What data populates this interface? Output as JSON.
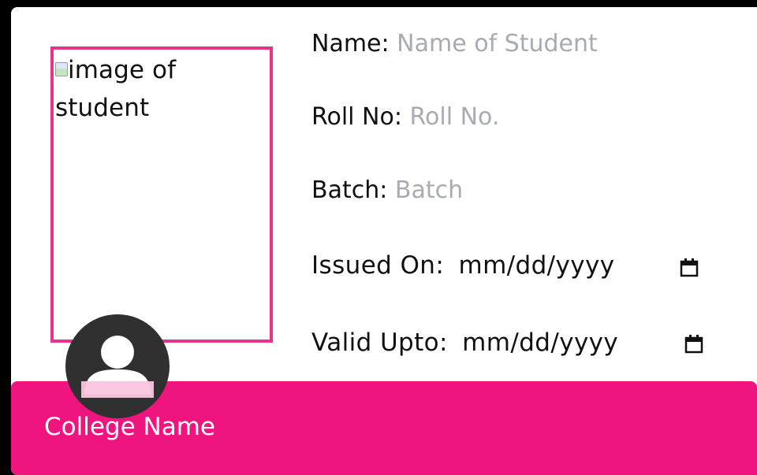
{
  "photo": {
    "alt_text": "image of student"
  },
  "fields": {
    "name": {
      "label": "Name:",
      "value": "Name of Student"
    },
    "roll": {
      "label": "Roll No:",
      "value": "Roll No."
    },
    "batch": {
      "label": "Batch:",
      "value": "Batch"
    },
    "issued": {
      "label": "Issued On:",
      "value": "mm/dd/yyyy"
    },
    "valid": {
      "label": "Valid Upto:",
      "value": "mm/dd/yyyy"
    }
  },
  "footer": {
    "college_name": "College Name"
  },
  "icons": {
    "calendar": "calendar-icon",
    "avatar": "user-avatar-icon",
    "broken_image": "broken-image-icon"
  },
  "colors": {
    "accent": "#f0147f",
    "frame": "#e8338b",
    "placeholder": "#a8abb2",
    "avatar_bg": "#303030",
    "avatar_fg": "#ffffff",
    "avatar_accent": "#f8c6de"
  }
}
